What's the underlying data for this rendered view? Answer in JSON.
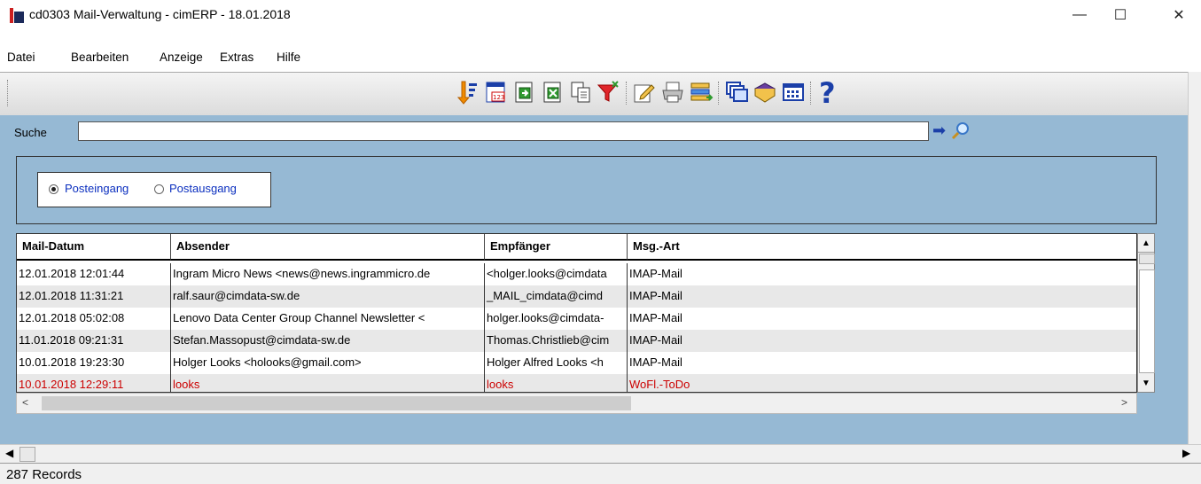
{
  "window": {
    "title": "cd0303 Mail-Verwaltung - cimERP - 18.01.2018",
    "minimize": "—",
    "maximize": "☐",
    "close": "✕"
  },
  "menu": [
    "Datei",
    "Bearbeiten",
    "Anzeige",
    "Extras",
    "Hilfe"
  ],
  "toolbar_icons": [
    "sort-icon",
    "calendar-123-icon",
    "export-icon",
    "excel-icon",
    "copy-icon",
    "filter-icon",
    "edit-icon",
    "print-icon",
    "list-transfer-icon",
    "windows-icon",
    "book-icon",
    "grid-view-icon",
    "help-icon"
  ],
  "search": {
    "label": "Suche",
    "value": "",
    "go_glyph": "➡"
  },
  "mailbox": {
    "options": [
      "Posteingang",
      "Postausgang"
    ],
    "selected": "Posteingang"
  },
  "table": {
    "columns": [
      "Mail-Datum",
      "Absender",
      "Empfänger",
      "Msg.-Art"
    ],
    "rows": [
      {
        "datum": "12.01.2018 12:01:44",
        "absender": "Ingram Micro News <news@news.ingrammicro.de",
        "empfaenger": "<holger.looks@cimdata",
        "art": "IMAP-Mail",
        "highlight": false
      },
      {
        "datum": "12.01.2018 11:31:21",
        "absender": "ralf.saur@cimdata-sw.de",
        "empfaenger": "_MAIL_cimdata@cimd",
        "art": "IMAP-Mail",
        "highlight": false
      },
      {
        "datum": "12.01.2018 05:02:08",
        "absender": "Lenovo Data Center Group Channel Newsletter <",
        "empfaenger": "holger.looks@cimdata-",
        "art": "IMAP-Mail",
        "highlight": false
      },
      {
        "datum": "11.01.2018 09:21:31",
        "absender": "Stefan.Massopust@cimdata-sw.de",
        "empfaenger": "Thomas.Christlieb@cim",
        "art": "IMAP-Mail",
        "highlight": false
      },
      {
        "datum": "10.01.2018 19:23:30",
        "absender": "Holger Looks <holooks@gmail.com>",
        "empfaenger": "Holger Alfred Looks <h",
        "art": "IMAP-Mail",
        "highlight": false
      },
      {
        "datum": "10.01.2018 12:29:11",
        "absender": "looks",
        "empfaenger": "looks",
        "art": "WoFl.-ToDo",
        "highlight": true
      }
    ]
  },
  "status": {
    "records": "287 Records"
  },
  "colors": {
    "panel_bg": "#96b9d4",
    "radio_label": "#0b2fbf",
    "highlight_row": "#cc0000"
  }
}
